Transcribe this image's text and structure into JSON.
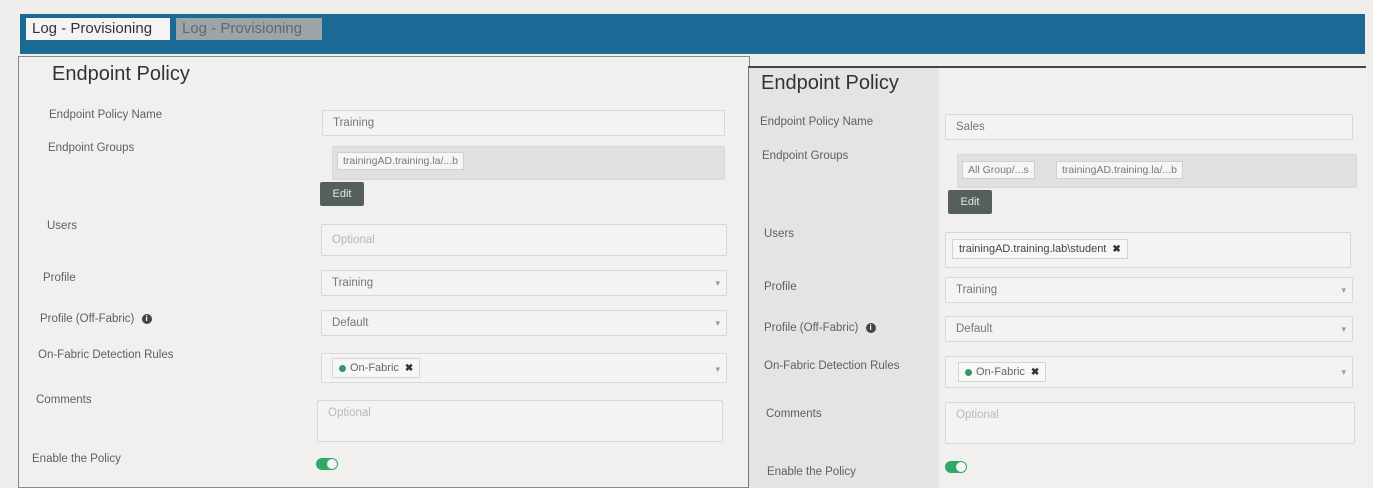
{
  "tabs": [
    {
      "label": "Log - Provisioning"
    },
    {
      "label": "Log - Provisioning"
    }
  ],
  "colors": {
    "header_bar": "#1b6a95",
    "toggle_on": "#2eaa66",
    "fabric_dot": "#2e9a65",
    "button": "#55605e"
  },
  "left_policy": {
    "title": "Endpoint Policy",
    "labels": {
      "name": "Endpoint Policy Name",
      "groups": "Endpoint Groups",
      "users": "Users",
      "profile": "Profile",
      "profile_off": "Profile (Off-Fabric)",
      "detection": "On-Fabric Detection Rules",
      "comments": "Comments",
      "enable": "Enable the Policy"
    },
    "name_value": "Training",
    "groups": [
      "trainingAD.training.la/...b"
    ],
    "edit_label": "Edit",
    "users_placeholder": "Optional",
    "profile_value": "Training",
    "profile_off_value": "Default",
    "detection_chip": "On-Fabric",
    "comments_placeholder": "Optional",
    "enabled": true
  },
  "right_policy": {
    "title": "Endpoint Policy",
    "labels": {
      "name": "Endpoint Policy Name",
      "groups": "Endpoint Groups",
      "users": "Users",
      "profile": "Profile",
      "profile_off": "Profile (Off-Fabric)",
      "detection": "On-Fabric Detection Rules",
      "comments": "Comments",
      "enable": "Enable the Policy"
    },
    "name_value": "Sales",
    "groups": [
      "All Group/...s",
      "trainingAD.training.la/...b"
    ],
    "edit_label": "Edit",
    "user_chip": "trainingAD.training.lab\\student",
    "profile_value": "Training",
    "profile_off_value": "Default",
    "detection_chip": "On-Fabric",
    "comments_placeholder": "Optional",
    "enabled": true
  }
}
